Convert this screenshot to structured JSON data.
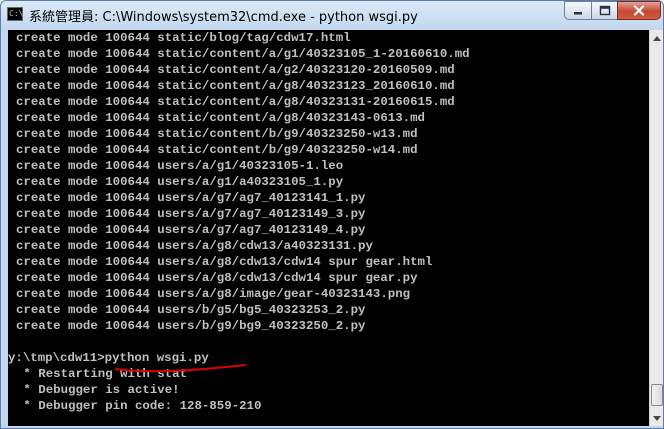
{
  "window": {
    "title": "系統管理員: C:\\Windows\\system32\\cmd.exe - python  wsgi.py",
    "app_icon_text": "C:\\",
    "controls": {
      "minimize": "minimize-icon",
      "maximize": "maximize-icon",
      "close": "close-icon"
    }
  },
  "console": {
    "lines": [
      "create mode 100644 static/blog/tag/cdw17.html",
      "create mode 100644 static/content/a/g1/40323105_1-20160610.md",
      "create mode 100644 static/content/a/g2/40323120-20160509.md",
      "create mode 100644 static/content/a/g8/40323123_20160610.md",
      "create mode 100644 static/content/a/g8/40323131-20160615.md",
      "create mode 100644 static/content/a/g8/40323143-0613.md",
      "create mode 100644 static/content/b/g9/40323250-w13.md",
      "create mode 100644 static/content/b/g9/40323250-w14.md",
      "create mode 100644 users/a/g1/40323105-1.leo",
      "create mode 100644 users/a/g1/a40323105_1.py",
      "create mode 100644 users/a/g7/ag7_40123141_1.py",
      "create mode 100644 users/a/g7/ag7_40123149_3.py",
      "create mode 100644 users/a/g7/ag7_40123149_4.py",
      "create mode 100644 users/a/g8/cdw13/a40323131.py",
      "create mode 100644 users/a/g8/cdw13/cdw14 spur gear.html",
      "create mode 100644 users/a/g8/cdw13/cdw14 spur gear.py",
      "create mode 100644 users/a/g8/image/gear-40323143.png",
      "create mode 100644 users/b/g5/bg5_40323253_2.py",
      "create mode 100644 users/b/g9/bg9_40323250_2.py",
      "",
      "y:\\tmp\\cdw11>python wsgi.py",
      " * Restarting with stat",
      " * Debugger is active!",
      " * Debugger pin code: 128-859-210"
    ],
    "text_color": "#c0c0c0",
    "background": "#000000",
    "annotation_color": "#e00000"
  },
  "scrollbar": {
    "up": "scroll-up-arrow-icon",
    "down": "scroll-down-arrow-icon"
  }
}
